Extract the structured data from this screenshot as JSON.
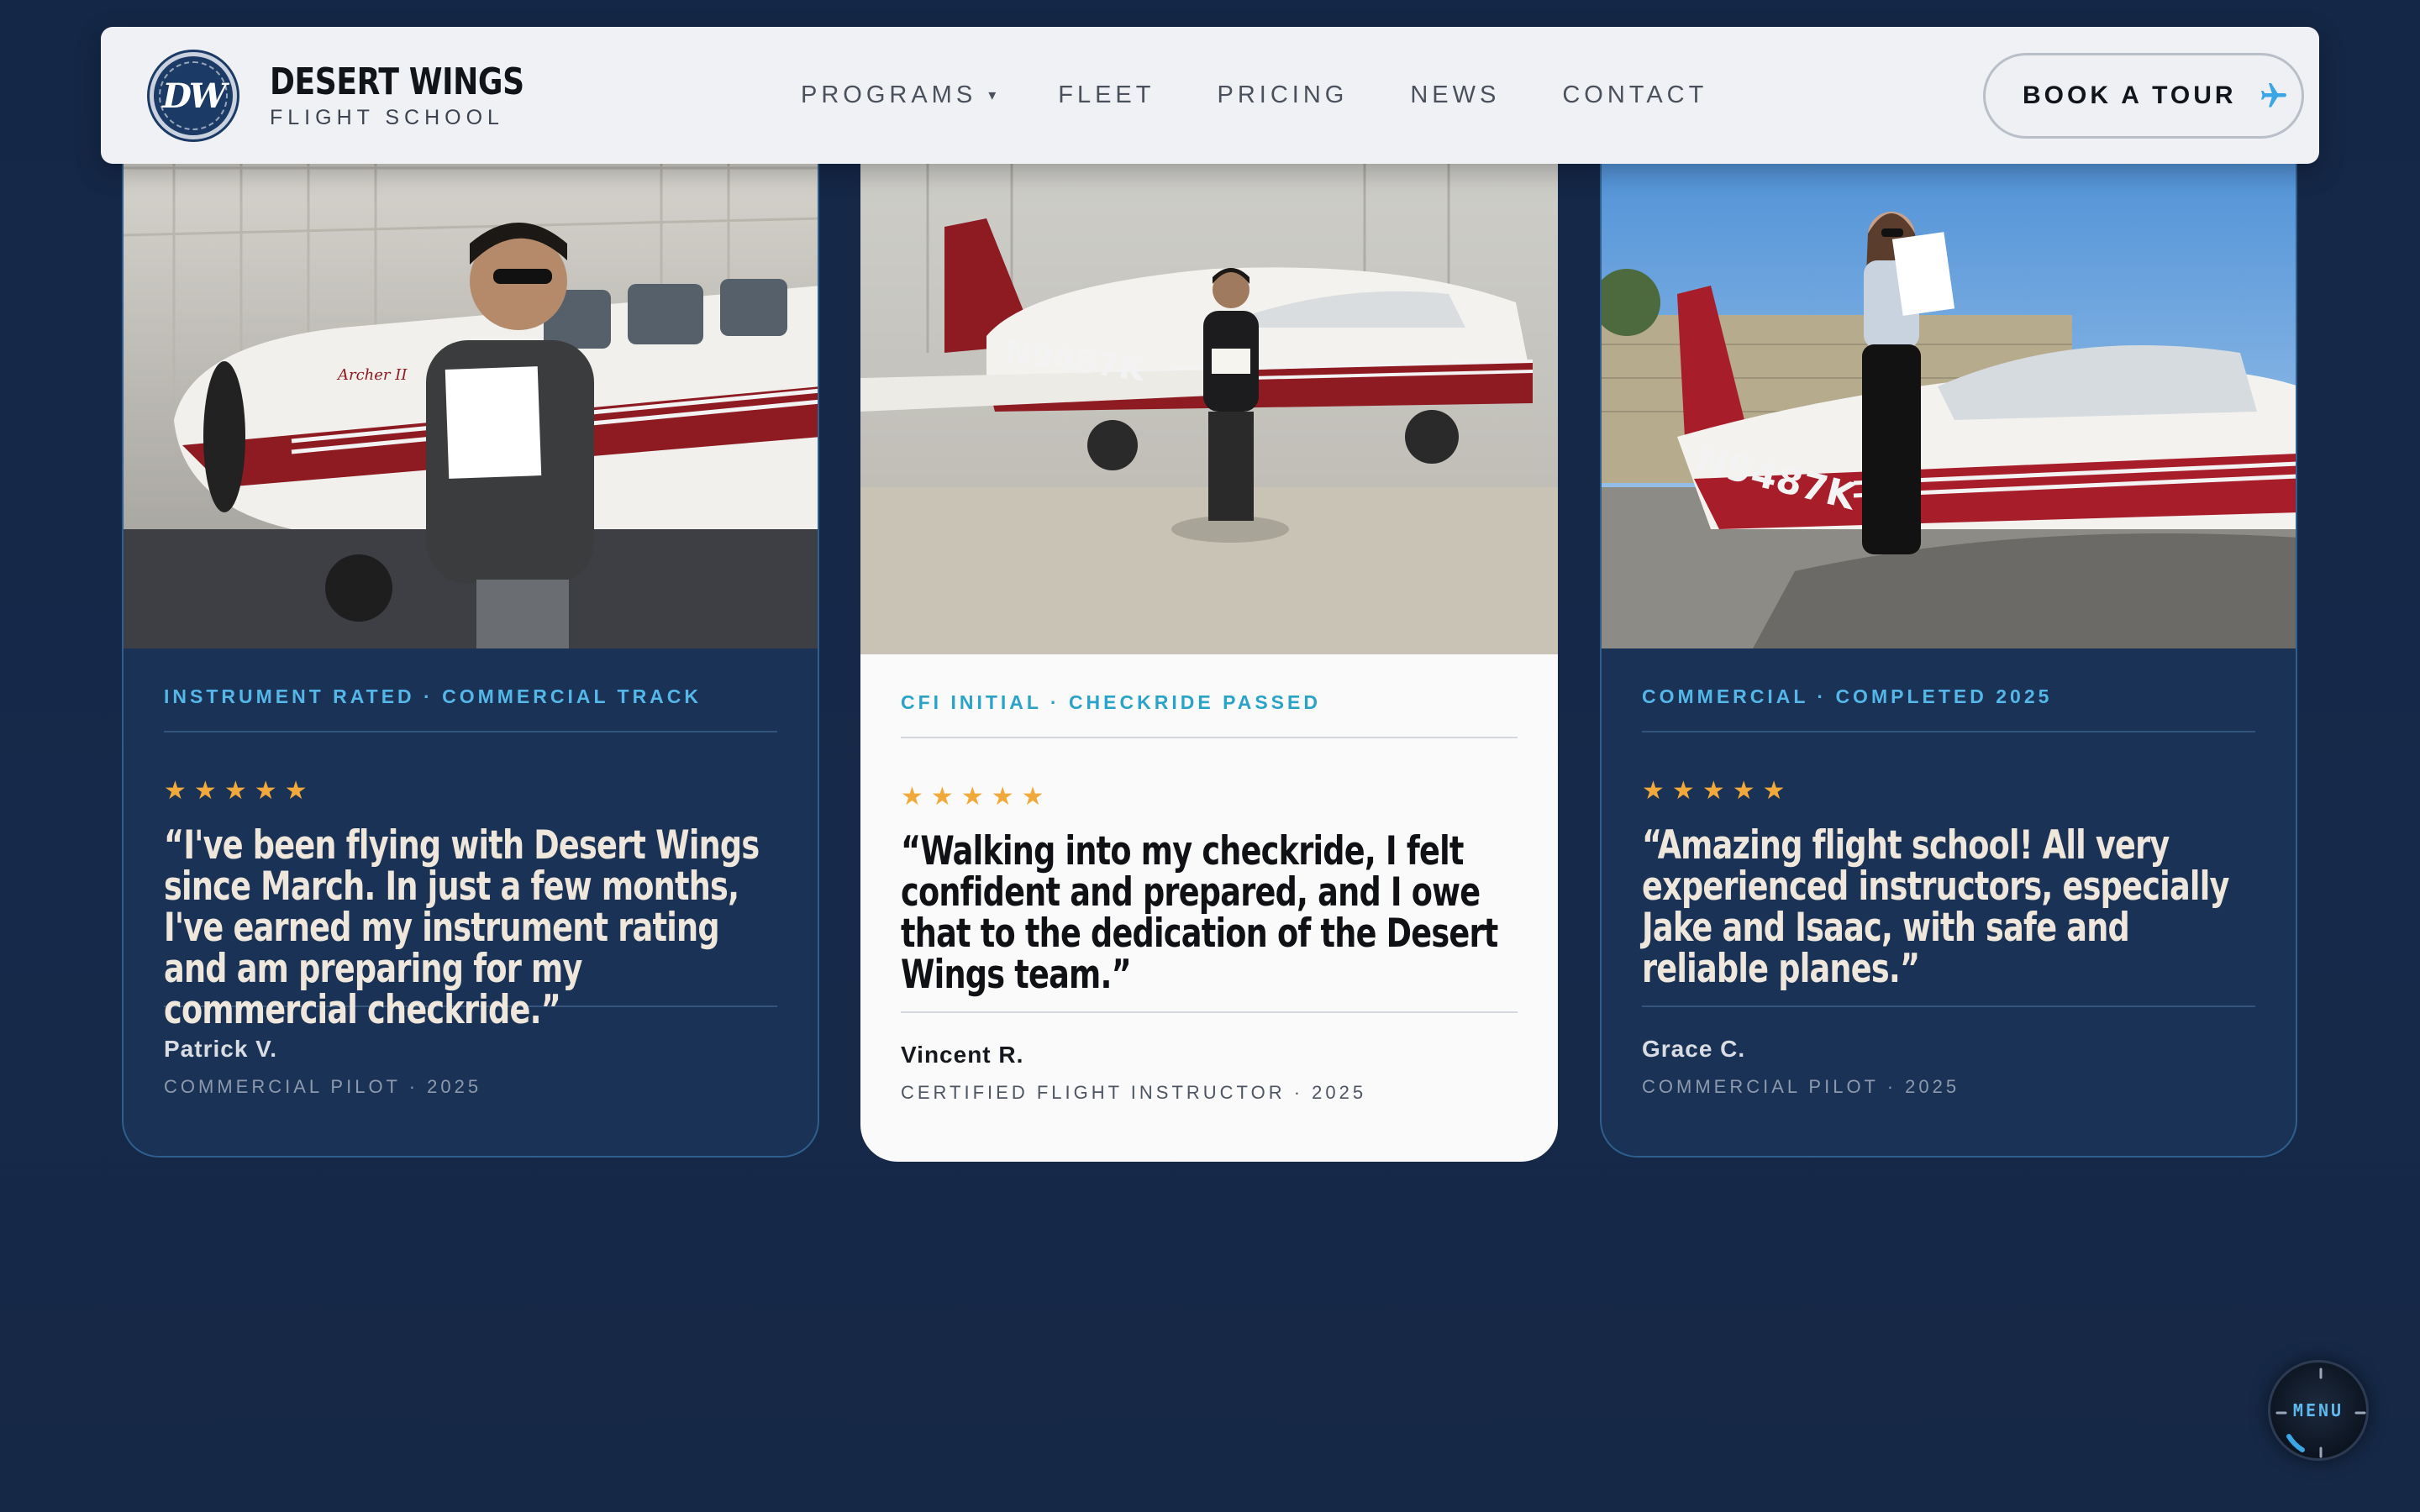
{
  "header": {
    "logo_text": "DW",
    "brand_name": "DESERT WINGS",
    "brand_sub": "FLIGHT SCHOOL",
    "nav": [
      {
        "label": "PROGRAMS",
        "has_dropdown": true
      },
      {
        "label": "FLEET"
      },
      {
        "label": "PRICING"
      },
      {
        "label": "NEWS"
      },
      {
        "label": "CONTACT"
      }
    ],
    "cta_label": "BOOK A TOUR",
    "cta_icon": "airplane-icon"
  },
  "testimonials": [
    {
      "tag": "INSTRUMENT RATED · COMMERCIAL TRACK",
      "rating": 5,
      "quote": "“I've been flying with Desert Wings since March. In just a few months, I've earned my instrument rating and am preparing for my commercial checkride.”",
      "author": "Patrick V.",
      "role": "COMMERCIAL PILOT · 2025",
      "photo": "student-with-certificate-in-hangar",
      "aircraft_label": "Archer II"
    },
    {
      "tag": "CFI INITIAL · CHECKRIDE PASSED",
      "rating": 5,
      "quote": "“Walking into my checkride, I felt confident and prepared, and I owe that to the dedication of the Desert Wings team.”",
      "author": "Vincent R.",
      "role": "CERTIFIED FLIGHT INSTRUCTOR · 2025",
      "photo": "instructor-with-certificate-in-hangar",
      "tail_number": "N9487K"
    },
    {
      "tag": "COMMERCIAL · COMPLETED 2025",
      "rating": 5,
      "quote": "“Amazing flight school! All very experienced instructors, especially Jake and Isaac, with safe and reliable planes.”",
      "author": "Grace C.",
      "role": "COMMERCIAL PILOT · 2025",
      "photo": "pilot-on-wing-with-certificate",
      "tail_number": "N9487K"
    }
  ],
  "menu_dial": {
    "label": "MENU"
  },
  "colors": {
    "page_bg": "#15294a",
    "header_bg": "#eff1f4",
    "accent": "#55b6e8",
    "star": "#f2a93b",
    "card_dark": "#1a3255",
    "card_light": "#fafafa",
    "aircraft_red": "#8e1a22"
  }
}
